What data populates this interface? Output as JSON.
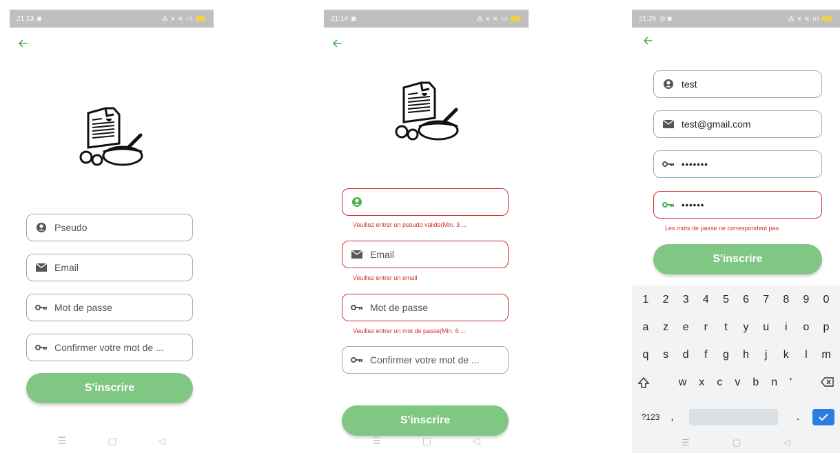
{
  "screen1": {
    "status_time": "21:13",
    "fields": [
      {
        "placeholder": "Pseudo"
      },
      {
        "placeholder": "Email"
      },
      {
        "placeholder": "Mot de passe"
      },
      {
        "placeholder": "Confirmer votre mot de ..."
      }
    ],
    "submit_label": "S'inscrire"
  },
  "screen2": {
    "status_time": "21:14",
    "fields": [
      {
        "value": "",
        "error": "Veuillez entrer un pseudo valide(Min. 3 ..."
      },
      {
        "placeholder": "Email",
        "error": "Veuillez entrer un email"
      },
      {
        "placeholder": "Mot de passe",
        "error": "Veuillez entrer un mot de passe(Min. 6 ..."
      },
      {
        "placeholder": "Confirmer votre mot de ..."
      }
    ],
    "submit_label": "S'inscrire"
  },
  "screen3": {
    "status_time": "21:26",
    "fields": [
      {
        "value": "test"
      },
      {
        "value": "test@gmail.com"
      },
      {
        "value": "•••••••"
      },
      {
        "value": "••••••",
        "error": "Les mots de passe ne correspondent pas"
      }
    ],
    "submit_label": "S'inscrire",
    "keyboard": {
      "row_numbers": [
        "1",
        "2",
        "3",
        "4",
        "5",
        "6",
        "7",
        "8",
        "9",
        "0"
      ],
      "row_1": [
        "a",
        "z",
        "e",
        "r",
        "t",
        "y",
        "u",
        "i",
        "o",
        "p"
      ],
      "row_2": [
        "q",
        "s",
        "d",
        "f",
        "g",
        "h",
        "j",
        "k",
        "l",
        "m"
      ],
      "row_3": [
        "w",
        "x",
        "c",
        "v",
        "b",
        "n",
        "'"
      ],
      "symbols_label": "?123",
      "comma": ",",
      "period": "."
    }
  },
  "colors": {
    "accent": "#4caf50",
    "button": "#80c784",
    "error": "#d32f2f",
    "statusbar": "#bfbfbf"
  },
  "icons": [
    "back-arrow-icon",
    "recipe-logo-icon",
    "user-icon",
    "mail-icon",
    "key-icon",
    "shift-icon",
    "backspace-icon",
    "check-icon"
  ]
}
